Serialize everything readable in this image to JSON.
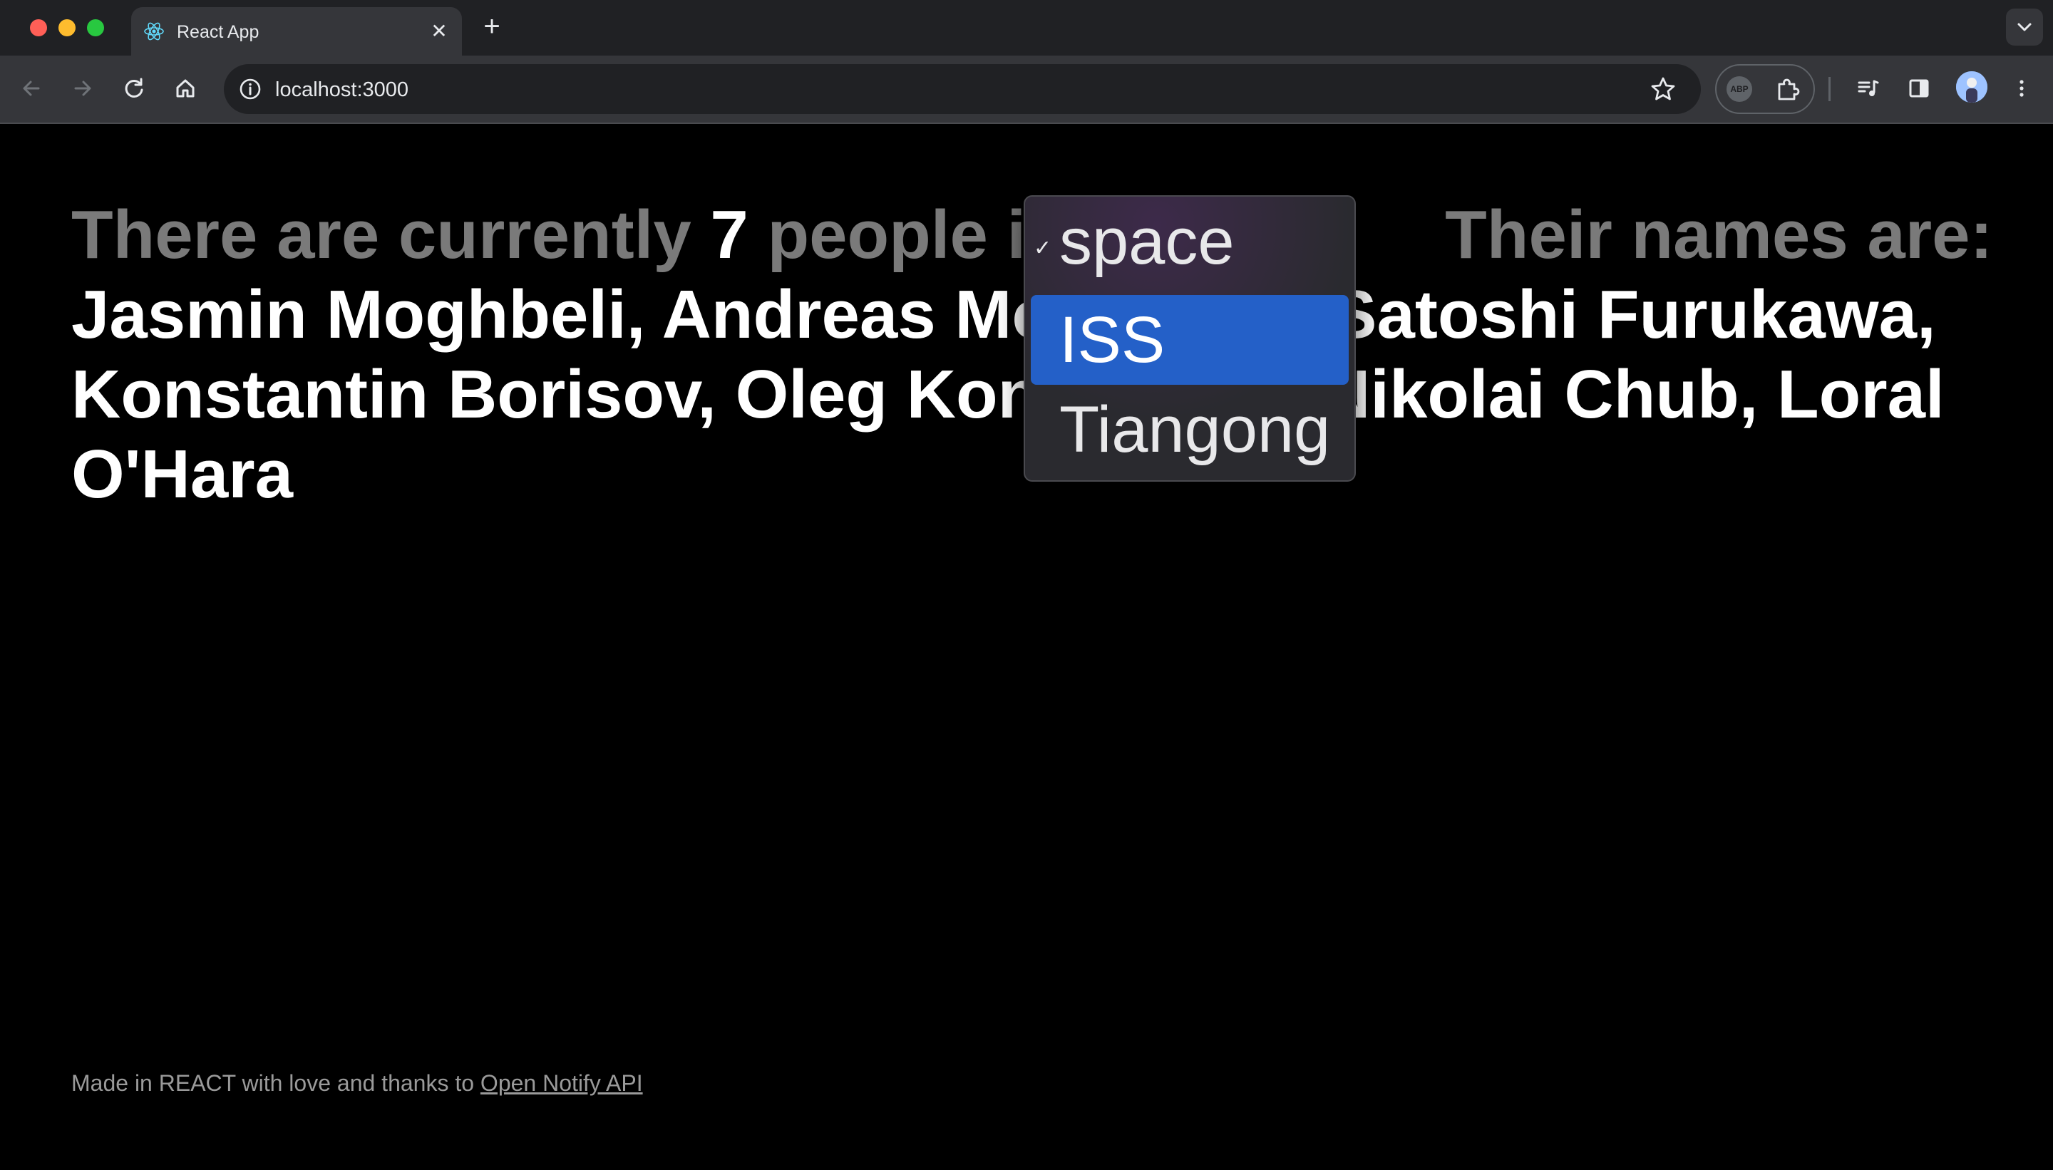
{
  "browser": {
    "tab_title": "React App",
    "url": "localhost:3000",
    "extension_badge": "ABP"
  },
  "page": {
    "intro_prefix": "There are currently",
    "count": "7",
    "intro_middle": "people in",
    "intro_suffix": "Their names are:",
    "names": "Jasmin Moghbeli, Andreas Mogensen, Satoshi Furukawa, Konstantin Borisov, Oleg Kononenko, Nikolai Chub, Loral O'Hara"
  },
  "dropdown": {
    "options": [
      "space",
      "ISS",
      "Tiangong"
    ],
    "checked": "space",
    "highlighted": "ISS"
  },
  "footer": {
    "text": "Made in REACT with love and thanks to",
    "link": "Open Notify API"
  },
  "colors": {
    "highlight": "#2460c8",
    "page_bg": "#000000",
    "muted_text": "#7a7a7a"
  }
}
